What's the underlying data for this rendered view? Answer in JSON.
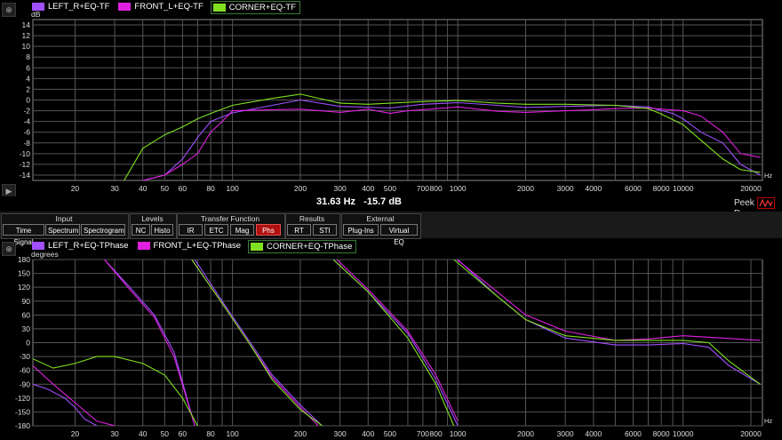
{
  "top": {
    "legend": [
      {
        "label": "LEFT_R+EQ-TF",
        "color": "#a050ff"
      },
      {
        "label": "FRONT_L+EQ-TF",
        "color": "#e020e0"
      },
      {
        "label": "CORNER+EQ-TF",
        "color": "#80e020"
      }
    ]
  },
  "bottom": {
    "legend": [
      {
        "label": "LEFT_R+EQ-TPhase",
        "color": "#a050ff"
      },
      {
        "label": "FRONT_L+EQ-TPhase",
        "color": "#e020e0"
      },
      {
        "label": "CORNER+EQ-TPhase",
        "color": "#80e020"
      }
    ]
  },
  "status": {
    "readout": "31.63 Hz   -15.7 dB",
    "peek_label": "Peek",
    "d_label": "D"
  },
  "toolbar": {
    "groups": [
      {
        "title": "Input",
        "buttons": [
          "Time Signal",
          "Spectrum",
          "Spectrogram"
        ]
      },
      {
        "title": "Levels",
        "buttons": [
          "NC",
          "Histo"
        ]
      },
      {
        "title": "Transfer Function",
        "buttons": [
          "IR",
          "ETC",
          "Mag",
          "Phs"
        ]
      },
      {
        "title": "Results",
        "buttons": [
          "RT",
          "STI"
        ]
      },
      {
        "title": "External",
        "buttons": [
          "Plug-Ins",
          "Virtual EQ"
        ]
      }
    ],
    "active": "Phs"
  },
  "chart_data": [
    {
      "type": "line",
      "ylabel": "dB",
      "xlabel": "Hz",
      "x_scale": "log",
      "xlim": [
        13,
        22500
      ],
      "ylim": [
        -15,
        15
      ],
      "x_ticks": [
        20,
        30,
        40,
        50,
        60,
        70,
        80,
        90,
        100,
        200,
        300,
        400,
        500,
        600,
        700,
        800,
        900,
        1000,
        2000,
        3000,
        4000,
        5000,
        6000,
        7000,
        8000,
        9000,
        10000,
        20000
      ],
      "x_tick_labels": [
        "20",
        "30",
        "40",
        "50",
        "60",
        "",
        "80",
        "",
        "100",
        "200",
        "300",
        "400",
        "500",
        "",
        "700",
        "800",
        "",
        "1000",
        "2000",
        "3000",
        "4000",
        "",
        "6000",
        "",
        "8000",
        "",
        "10000",
        "20000"
      ],
      "y_ticks": [
        -14,
        -12,
        -10,
        -8,
        -6,
        -4,
        -2,
        0,
        2,
        4,
        6,
        8,
        10,
        12,
        14
      ],
      "grid": true,
      "series": [
        {
          "name": "LEFT_R+EQ-TF",
          "color": "#a050ff",
          "x": [
            40,
            50,
            60,
            70,
            80,
            100,
            150,
            200,
            300,
            500,
            700,
            1000,
            1500,
            2000,
            3000,
            5000,
            7000,
            9000,
            10000,
            12000,
            15000,
            18000,
            22000
          ],
          "y": [
            -15,
            -14,
            -11,
            -7,
            -4,
            -2.4,
            -1,
            0,
            -1.2,
            -1.5,
            -0.8,
            -0.5,
            -1,
            -1.4,
            -1.2,
            -1,
            -1.3,
            -2.5,
            -3.5,
            -6,
            -8,
            -12,
            -14
          ]
        },
        {
          "name": "FRONT_L+EQ-TF",
          "color": "#e020e0",
          "x": [
            40,
            50,
            60,
            70,
            80,
            90,
            100,
            150,
            200,
            300,
            400,
            500,
            600,
            700,
            1000,
            1500,
            2000,
            3000,
            4000,
            5000,
            7000,
            10000,
            12000,
            15000,
            18000,
            22000
          ],
          "y": [
            -15,
            -14,
            -12,
            -10,
            -6,
            -4,
            -2,
            -1.8,
            -1.7,
            -2.3,
            -1.7,
            -2.5,
            -2,
            -1.8,
            -1.3,
            -2.1,
            -2.3,
            -2,
            -1.8,
            -1.6,
            -1.5,
            -2,
            -3,
            -6,
            -10,
            -10.7
          ]
        },
        {
          "name": "CORNER+EQ-TF",
          "color": "#80e020",
          "x": [
            33,
            40,
            50,
            60,
            70,
            80,
            100,
            150,
            200,
            300,
            400,
            500,
            700,
            1000,
            1500,
            2000,
            3000,
            5000,
            7000,
            8000,
            10000,
            12000,
            15000,
            18000,
            22000
          ],
          "y": [
            -15,
            -9,
            -6.5,
            -5,
            -3.5,
            -2.5,
            -1,
            0.3,
            1.1,
            -0.6,
            -0.8,
            -0.6,
            -0.3,
            -0.1,
            -0.6,
            -0.8,
            -0.8,
            -1,
            -1.6,
            -2.6,
            -4.6,
            -7.5,
            -11,
            -13,
            -13.5
          ]
        }
      ]
    },
    {
      "type": "line",
      "ylabel": "degrees",
      "xlabel": "Hz",
      "x_scale": "log",
      "xlim": [
        13,
        22500
      ],
      "ylim": [
        -180,
        180
      ],
      "x_ticks": [
        20,
        30,
        40,
        50,
        60,
        70,
        80,
        90,
        100,
        200,
        300,
        400,
        500,
        600,
        700,
        800,
        900,
        1000,
        2000,
        3000,
        4000,
        5000,
        6000,
        7000,
        8000,
        9000,
        10000,
        20000
      ],
      "x_tick_labels": [
        "20",
        "30",
        "40",
        "50",
        "60",
        "",
        "80",
        "",
        "100",
        "200",
        "300",
        "400",
        "500",
        "",
        "700",
        "800",
        "",
        "1000",
        "2000",
        "3000",
        "4000",
        "",
        "6000",
        "",
        "8000",
        "",
        "10000",
        "20000"
      ],
      "y_ticks": [
        -180,
        -150,
        -120,
        -90,
        -60,
        -30,
        0,
        30,
        60,
        90,
        120,
        150,
        180
      ],
      "grid": true,
      "series": [
        {
          "name": "LEFT_R+EQ-TPhase",
          "color": "#a050ff",
          "segments": [
            {
              "x": [
                13,
                15,
                18,
                20,
                22,
                25
              ],
              "y": [
                -90,
                -100,
                -120,
                -140,
                -165,
                -180
              ]
            },
            {
              "x": [
                27,
                35,
                45,
                55,
                68
              ],
              "y": [
                180,
                120,
                60,
                -20,
                -180
              ]
            },
            {
              "x": [
                68,
                90,
                120,
                150,
                200,
                250
              ],
              "y": [
                180,
                90,
                0,
                -70,
                -135,
                -180
              ]
            },
            {
              "x": [
                280,
                400,
                600,
                800,
                1000
              ],
              "y": [
                180,
                110,
                20,
                -80,
                -180
              ]
            },
            {
              "x": [
                1000,
                1500,
                2000,
                3000,
                5000,
                7000,
                10000,
                13000,
                16000,
                22000
              ],
              "y": [
                180,
                100,
                50,
                10,
                -5,
                -5,
                -2,
                -10,
                -50,
                -90
              ]
            }
          ]
        },
        {
          "name": "FRONT_L+EQ-TPhase",
          "color": "#e020e0",
          "segments": [
            {
              "x": [
                13,
                16,
                20,
                25,
                30
              ],
              "y": [
                -50,
                -90,
                -130,
                -170,
                -180
              ]
            },
            {
              "x": [
                27,
                35,
                45,
                55,
                68
              ],
              "y": [
                180,
                115,
                55,
                -30,
                -180
              ]
            },
            {
              "x": [
                66,
                90,
                120,
                150,
                200,
                240
              ],
              "y": [
                180,
                85,
                -5,
                -75,
                -140,
                -180
              ]
            },
            {
              "x": [
                290,
                400,
                600,
                800,
                1000
              ],
              "y": [
                180,
                115,
                25,
                -70,
                -170
              ]
            },
            {
              "x": [
                990,
                1500,
                2000,
                3000,
                5000,
                7000,
                10000,
                15000,
                22000
              ],
              "y": [
                180,
                110,
                60,
                25,
                5,
                8,
                15,
                10,
                5
              ]
            }
          ]
        },
        {
          "name": "CORNER+EQ-TPhase",
          "color": "#80e020",
          "segments": [
            {
              "x": [
                13,
                16,
                20,
                25,
                30,
                40,
                50,
                60,
                70
              ],
              "y": [
                -35,
                -55,
                -45,
                -30,
                -30,
                -45,
                -70,
                -120,
                -180
              ]
            },
            {
              "x": [
                66,
                90,
                120,
                150,
                200,
                250
              ],
              "y": [
                180,
                85,
                -5,
                -80,
                -145,
                -180
              ]
            },
            {
              "x": [
                280,
                400,
                600,
                800,
                960
              ],
              "y": [
                180,
                110,
                10,
                -90,
                -180
              ]
            },
            {
              "x": [
                960,
                1500,
                2000,
                3000,
                5000,
                7000,
                10000,
                13000,
                16000,
                22000
              ],
              "y": [
                180,
                100,
                50,
                15,
                5,
                5,
                5,
                0,
                -40,
                -90
              ]
            }
          ]
        }
      ]
    }
  ]
}
